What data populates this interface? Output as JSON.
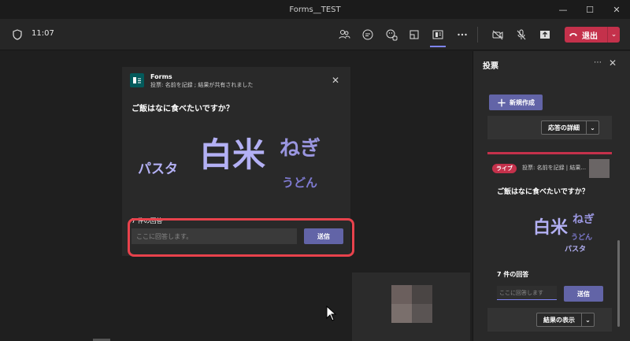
{
  "window": {
    "title": "Forms__TEST"
  },
  "toolbar": {
    "time": "11:07",
    "leave_label": "退出"
  },
  "form_card": {
    "app_name": "Forms",
    "subtitle": "投票: 名前を記録 ; 結果が共有されました",
    "question": "ご飯はなに食べたいですか？",
    "words": [
      "白米",
      "ねぎ",
      "パスタ",
      "うどん"
    ],
    "response_count": "7 件の回答",
    "input_placeholder": "ここに回答します。",
    "send_label": "送信"
  },
  "panel": {
    "title": "投票",
    "new_button": "新規作成",
    "details_button": "応答の詳細",
    "live_badge": "ライブ",
    "card_subtitle": "投票: 名前を記録 | 結果...",
    "question": "ご飯はなに食べたいですか？",
    "words": [
      "白米",
      "ねぎ",
      "うどん",
      "パスタ"
    ],
    "response_count": "7 件の回答",
    "input_placeholder": "ここに回答します",
    "send_label": "送信",
    "results_button": "結果の表示"
  },
  "colors": {
    "accent": "#6264a7",
    "leave": "#c4314b",
    "highlight": "#e8424c",
    "word": "#b3b0f4"
  }
}
